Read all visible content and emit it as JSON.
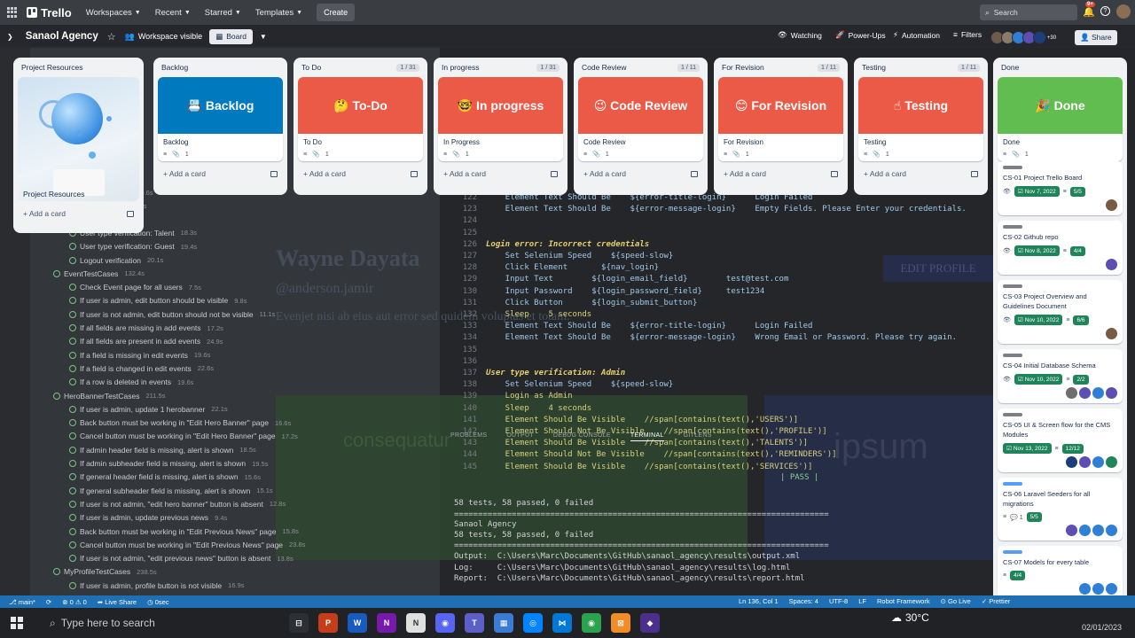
{
  "topnav": {
    "logo": "Trello",
    "menus": [
      "Workspaces",
      "Recent",
      "Starred",
      "Templates"
    ],
    "create": "Create",
    "search_placeholder": "Search",
    "notif_count": "9+"
  },
  "board": {
    "title": "Sanaol Agency",
    "visibility": "Workspace visible",
    "view": "Board",
    "watching": "Watching",
    "powerups": "Power-Ups",
    "automation": "Automation",
    "filters": "Filters",
    "members_extra": "+30",
    "share": "Share"
  },
  "lists": [
    {
      "title": "Project Resources",
      "card": "Project Resources",
      "add": "Add a card"
    },
    {
      "title": "Backlog",
      "count": "",
      "cover": "📇 Backlog",
      "cover_color": "#0079bf",
      "card": "Backlog",
      "add": "Add a card"
    },
    {
      "title": "To Do",
      "count": "1 / 31",
      "cover": "🤔 To-Do",
      "cover_color": "#eb5a46",
      "card": "To Do",
      "add": "Add a card"
    },
    {
      "title": "In progress",
      "count": "1 / 31",
      "cover": "🤓 In progress",
      "cover_color": "#eb5a46",
      "card": "In Progress",
      "add": "Add a card"
    },
    {
      "title": "Code Review",
      "count": "1 / 11",
      "cover": "😉 Code Review",
      "cover_color": "#eb5a46",
      "card": "Code Review",
      "add": "Add a card"
    },
    {
      "title": "For Revision",
      "count": "1 / 11",
      "cover": "😊 For Revision",
      "cover_color": "#eb5a46",
      "card": "For Revision",
      "add": "Add a card"
    },
    {
      "title": "Testing",
      "count": "1 / 11",
      "cover": "☝ Testing",
      "cover_color": "#eb5a46",
      "card": "Testing",
      "add": "Add a card"
    },
    {
      "title": "Done",
      "count": "",
      "cover": "🎉 Done",
      "cover_color": "#61bd4f",
      "card": "Done",
      "add": "Add a card"
    }
  ],
  "done_cards": [
    {
      "title": "CS-01 Project Trello Board",
      "date": "Nov 7, 2022",
      "check": "5/5",
      "members": [
        "#7a5a44"
      ]
    },
    {
      "title": "CS-02 Github repo",
      "date": "Nov 8, 2022",
      "check": "4/4",
      "members": [
        "#5e4db2"
      ]
    },
    {
      "title": "CS-03 Project Overview and Guidelines Document",
      "date": "Nov 10, 2022",
      "check": "6/6",
      "members": [
        "#7a5a44"
      ]
    },
    {
      "title": "CS-04 Initial Database Schema",
      "date": "Nov 10, 2022",
      "check": "2/2",
      "members": [
        "#6e6e6e",
        "#5e4db2",
        "#2f7fd6",
        "#5e4db2"
      ]
    },
    {
      "title": "CS-05 UI & Screen flow for the CMS Modules",
      "date": "Nov 13, 2022",
      "check": "12/12",
      "members": [
        "#1d3e7a",
        "#5e4db2",
        "#2f7fd6",
        "#1f845a"
      ]
    },
    {
      "title": "CS-06 Laravel Seeders for all migrations",
      "date": "",
      "check": "5/5",
      "members": [
        "#5e4db2",
        "#2f7fd6",
        "#2f7fd6",
        "#2f7fd6"
      ]
    },
    {
      "title": "CS-07 Models for every table",
      "date": "",
      "check": "4/4",
      "members": [
        "#2f7fd6",
        "#2f7fd6",
        "#2f7fd6"
      ]
    },
    {
      "title": "CS-08 General Header + Navbar + Routing (FE)",
      "date": "Nov 20, 2022",
      "check": "6/6",
      "members": [
        "#2f7fd6",
        "#2f7fd6"
      ]
    }
  ],
  "done_add": "Add a card",
  "vscode": {
    "filter_placeholder": "Filter (e.g. text, !exclude, @tag)",
    "tree": [
      "lete credentials",
      "ct credentials",
      "tion: Admin",
      "User type verification: Talent",
      "User type verification: Guest",
      "Logout verification",
      "EventTestCases",
      "Check Event page for all users",
      "If user is admin, edit button should be visible",
      "If user is not admin, edit button should not be visible",
      "If all fields are missing in add events",
      "If all fields are present in add events",
      "If a field is missing in edit events",
      "If a field is changed in edit events",
      "If a row is deleted in events",
      "HeroBannerTestCases",
      "If user is admin, update 1 herobanner",
      "Back button must be working in \"Edit Hero Banner\" page",
      "Cancel button must be working in \"Edit Hero Banner\" page",
      "If admin header field is missing, alert is shown",
      "If admin subheader field is missing, alert is shown",
      "If general header field is missing, alert is shown",
      "If general subheader field is missing, alert is shown",
      "If user is not admin, \"edit hero banner\" button is absent",
      "If user is admin, update previous news",
      "Back button must be working in \"Edit Previous News\" page",
      "Cancel button must be working in \"Edit Previous News\" page",
      "If user is not admin, \"edit previous news\" button is absent",
      "MyProfileTestCases",
      "If user is admin, profile button is not visible"
    ],
    "tree_times": [
      "10.6s",
      "16.2s",
      "20.1s",
      "18.3s",
      "19.4s",
      "20.1s",
      "132.4s",
      "7.5s",
      "9.8s",
      "11.1s",
      "17.2s",
      "24.9s",
      "19.6s",
      "22.6s",
      "19.6s",
      "211.5s",
      "22.1s",
      "16.6s",
      "17.2s",
      "18.5s",
      "19.5s",
      "15.6s",
      "15.1s",
      "12.8s",
      "9.4s",
      "15.8s",
      "23.8s",
      "13.8s",
      "238.5s",
      "16.9s"
    ],
    "breadcrumb": "vue > selenium > Account TestCases.robot > Test Cases",
    "code": [
      {
        "n": "122",
        "text": "    Element Text Should Be    ${error-title-login}      Login Failed"
      },
      {
        "n": "123",
        "text": "    Element Text Should Be    ${error-message-login}    Empty Fields. Please Enter your credentials."
      },
      {
        "n": "124",
        "text": ""
      },
      {
        "n": "125",
        "text": ""
      },
      {
        "n": "126",
        "text": "Login error: Incorrect credentials"
      },
      {
        "n": "127",
        "text": "    Set Selenium Speed    ${speed-slow}"
      },
      {
        "n": "128",
        "text": "    Click Element       ${nav_login}"
      },
      {
        "n": "129",
        "text": "    Input Text        ${login_email_field}        test@test.com"
      },
      {
        "n": "130",
        "text": "    Input Password    ${login_password_field}     test1234"
      },
      {
        "n": "131",
        "text": "    Click Button      ${login_submit_button}"
      },
      {
        "n": "132",
        "text": "    Sleep    5 seconds"
      },
      {
        "n": "133",
        "text": "    Element Text Should Be    ${error-title-login}      Login Failed"
      },
      {
        "n": "134",
        "text": "    Element Text Should Be    ${error-message-login}    Wrong Email or Password. Please try again."
      },
      {
        "n": "135",
        "text": ""
      },
      {
        "n": "136",
        "text": ""
      },
      {
        "n": "137",
        "text": "User type verification: Admin"
      },
      {
        "n": "138",
        "text": "    Set Selenium Speed    ${speed-slow}"
      },
      {
        "n": "139",
        "text": "    Login as Admin"
      },
      {
        "n": "140",
        "text": "    Sleep    4 seconds"
      },
      {
        "n": "141",
        "text": "    Element Should Be Visible    //span[contains(text(),'USERS')]"
      },
      {
        "n": "142",
        "text": "    Element Should Not Be Visible    //span[contains(text(),'PROFILE')]"
      },
      {
        "n": "143",
        "text": "    Element Should Be Visible    //span[contains(text(),'TALENTS')]"
      },
      {
        "n": "144",
        "text": "    Element Should Not Be Visible    //span[contains(text(),'REMINDERS')]"
      },
      {
        "n": "145",
        "text": "    Element Should Be Visible    //span[contains(text(),'SERVICES')]"
      }
    ],
    "term_tabs": [
      "PROBLEMS",
      "OUTPUT",
      "DEBUG CONSOLE",
      "TERMINAL",
      "GITLENS"
    ],
    "term": [
      "58 tests, 58 passed, 0 failed",
      "==============================================================================",
      "Sanaol Agency",
      "58 tests, 58 passed, 0 failed",
      "==============================================================================",
      "Output:  C:\\Users\\Marc\\Documents\\GitHub\\sanaol_agency\\results\\output.xml",
      "Log:     C:\\Users\\Marc\\Documents\\GitHub\\sanaol_agency\\results\\log.html",
      "Report:  C:\\Users\\Marc\\Documents\\GitHub\\sanaol_agency\\results\\report.html"
    ],
    "pass": "| PASS |",
    "bg_name": "Wayne Dayata",
    "bg_handle": "@anderson.jamir",
    "bg_lorem": "Evenjet nisi ab eius aut error sed quidem voluptas et totam.",
    "bg_edit": "EDIT PROFILE",
    "bg_word1": "consequatur",
    "bg_word2": "ipsum"
  },
  "statusbar": {
    "branch": "main*",
    "errors": "⊗ 0 ⚠ 0",
    "live": "Live Share",
    "time": "0sec",
    "pos": "Ln 136, Col 1",
    "spaces": "Spaces: 4",
    "enc": "UTF-8",
    "eol": "LF",
    "lang": "Robot Framework",
    "golive": "Go Live",
    "prettier": "Prettier"
  },
  "taskbar": {
    "search": "Type here to search",
    "temp": "30°C",
    "date": "02/01/2023",
    "apps": [
      {
        "label": "⊟",
        "color": "#2c2f33"
      },
      {
        "label": "P",
        "color": "#c43e1c"
      },
      {
        "label": "W",
        "color": "#185abd"
      },
      {
        "label": "N",
        "color": "#7719aa"
      },
      {
        "label": "N",
        "color": "#e0e0e0"
      },
      {
        "label": "◉",
        "color": "#5865f2"
      },
      {
        "label": "T",
        "color": "#5b5fc7"
      },
      {
        "label": "▦",
        "color": "#3a7bd5"
      },
      {
        "label": "◎",
        "color": "#0084ff"
      },
      {
        "label": "⋈",
        "color": "#0078d4"
      },
      {
        "label": "◉",
        "color": "#2ba24c"
      },
      {
        "label": "⊠",
        "color": "#f28c28"
      },
      {
        "label": "◆",
        "color": "#4c2f8c"
      }
    ]
  }
}
